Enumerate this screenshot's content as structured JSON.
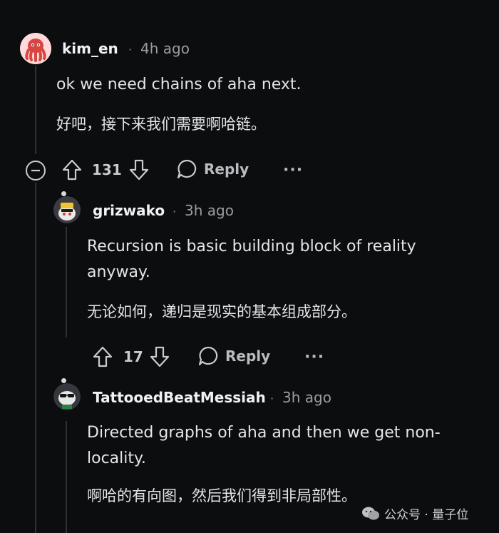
{
  "comments": [
    {
      "username": "kim_en",
      "separator": "·",
      "time": "4h ago",
      "text": "ok we need chains of aha next.",
      "translation": "好吧，接下来我们需要啊哈链。",
      "votes": "131",
      "reply_label": "Reply",
      "more_label": "···",
      "avatar_icon": "octopus-avatar-icon"
    },
    {
      "username": "grizwako",
      "separator": "·",
      "time": "3h ago",
      "text": "Recursion is basic building block of reality anyway.",
      "translation": "无论如何，递归是现实的基本组成部分。",
      "votes": "17",
      "reply_label": "Reply",
      "more_label": "···",
      "avatar_icon": "snoo-avatar-icon"
    },
    {
      "username": "TattooedBeatMessiah",
      "separator": "·",
      "time": "3h ago",
      "text": "Directed graphs of aha and then we get non-locality.",
      "translation": "啊哈的有向图，然后我们得到非局部性。",
      "avatar_icon": "snoo-sunglasses-avatar-icon"
    }
  ],
  "watermark": {
    "text": "公众号 · 量子位",
    "icon": "wechat-icon"
  }
}
